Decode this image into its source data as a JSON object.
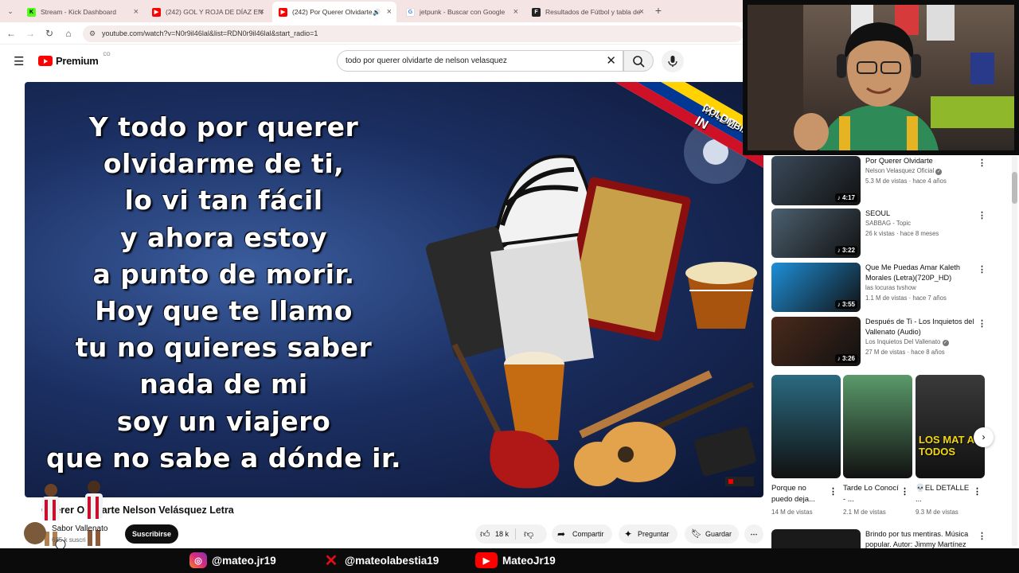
{
  "browser": {
    "tabs": [
      {
        "title": "Stream - Kick Dashboard",
        "favicon": "kick-icon",
        "color": "#53fc18"
      },
      {
        "title": "(242) GOL Y ROJA DE DÍAZ EN",
        "favicon": "youtube-icon",
        "color": "#ff0000"
      },
      {
        "title": "(242) Por Querer Olvidarte",
        "favicon": "youtube-icon",
        "color": "#ff0000",
        "active": true
      },
      {
        "title": "jetpunk - Buscar con Google",
        "favicon": "google-icon",
        "color": "#4285f4"
      },
      {
        "title": "Resultados de Fútbol y tabla de",
        "favicon": "flashscore-icon",
        "color": "#222222"
      }
    ],
    "new_tab": "+",
    "url": "youtube.com/watch?v=N0r9il46lal&list=RDN0r9il46lal&start_radio=1"
  },
  "youtube": {
    "logo_text": "Premium",
    "logo_region": "CO",
    "search_value": "todo por querer olvidarte de nelson velasquez"
  },
  "video": {
    "lyrics": [
      "Y todo por querer",
      "olvidarme de ti,",
      "lo vi tan fácil",
      "y ahora estoy",
      "a punto de morir.",
      "Hoy que te llamo",
      "tu no quieres saber",
      "nada de mi",
      "soy un viajero",
      "que no sabe a dónde ir."
    ],
    "ribbon_text": "MADE IN",
    "ribbon_sub": "COLOMBIA",
    "title": "Querer Olvidarte Nelson Velásquez Letra",
    "channel": "Sabor Vallenato",
    "subscribers": "685 k suscri",
    "subscribe_label": "Suscribirse",
    "likes": "18 k",
    "share_label": "Compartir",
    "ask_label": "Preguntar",
    "save_label": "Guardar"
  },
  "recommendations": [
    {
      "title": "Por Querer Olvidarte",
      "channel": "Nelson Velasquez Oficial",
      "verified": true,
      "meta": "5.3 M de vistas · hace 4 años",
      "duration": "4:17",
      "color": "#3a4a5a"
    },
    {
      "title": "SEOUL",
      "channel": "SABBAG - Topic",
      "verified": false,
      "meta": "26 k vistas · hace 8 meses",
      "duration": "3:22",
      "color": "#4c6070"
    },
    {
      "title": "Que Me Puedas Amar Kaleth Morales (Letra)(720P_HD)",
      "channel": "las locuras tvshow",
      "verified": false,
      "meta": "1.1 M de vistas · hace 7 años",
      "duration": "3:55",
      "color": "#1e8fd8"
    },
    {
      "title": "Después de Ti - Los Inquietos del Vallenato (Audio)",
      "channel": "Los Inquietos Del Vallenato",
      "verified": true,
      "meta": "27 M de vistas · hace 8 años",
      "duration": "3:26",
      "color": "#4a2a1c"
    }
  ],
  "shorts": [
    {
      "title": "Porque no puedo deja...",
      "views": "14 M de vistas",
      "color": "#2a6a80"
    },
    {
      "title": "Tarde Lo Conocí - ...",
      "views": "2.1 M de vistas",
      "color": "#5a9a6a"
    },
    {
      "title": "💀EL DETALLE ...",
      "views": "9.3 M de vistas",
      "color": "#3a3a3a",
      "overlay": "LOS MAT A TODOS"
    }
  ],
  "next_rec": {
    "title": "Brindo por tus mentiras. Música popular. Autor: Jimmy Martínez"
  },
  "stream_overlay": {
    "instagram": "@mateo.jr19",
    "x": "@mateolabestia19",
    "youtube": "MateoJr19"
  }
}
